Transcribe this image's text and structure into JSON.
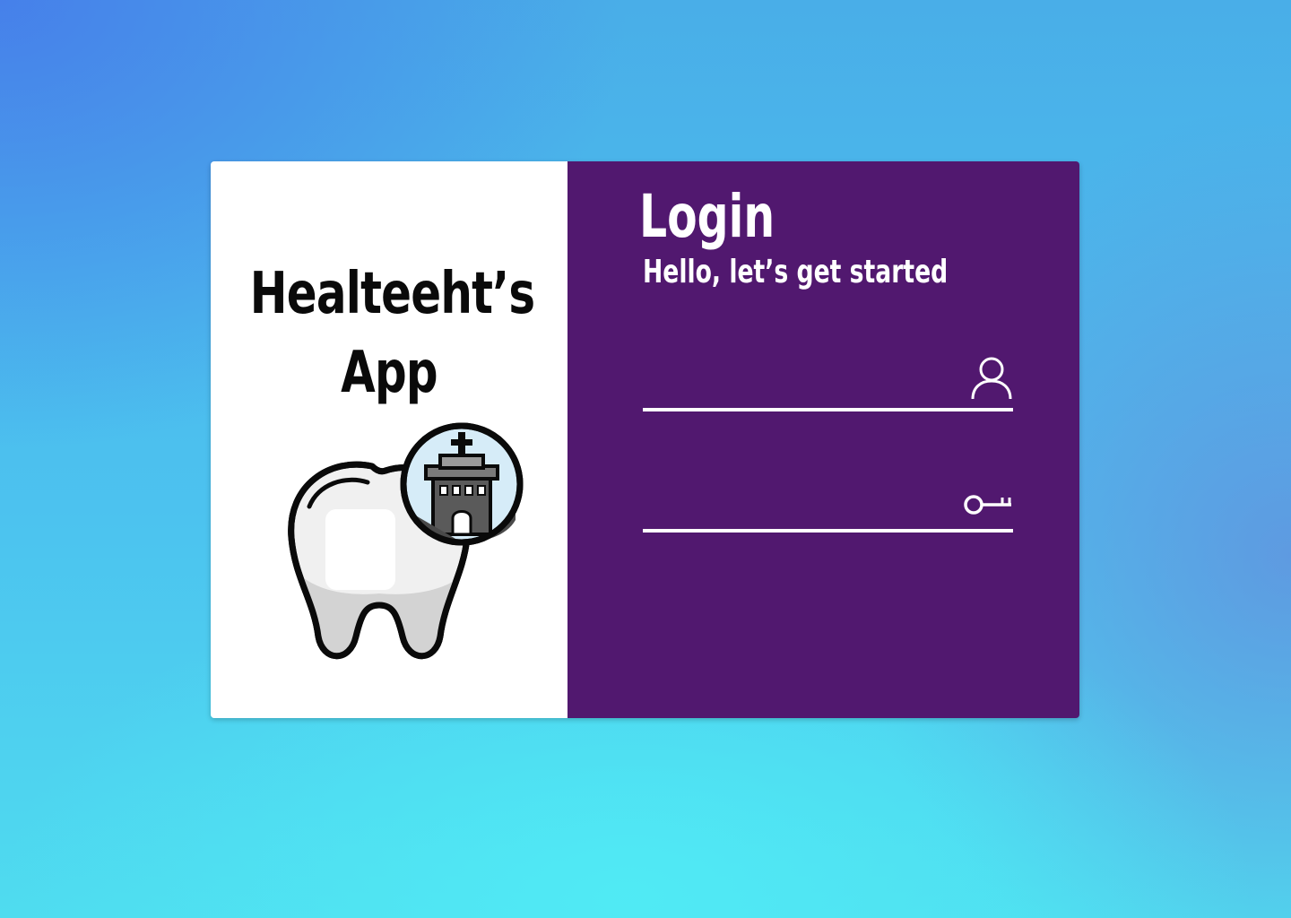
{
  "brand": {
    "title_line1": "Healteeht’s",
    "title_line2": "App",
    "logo_icon": "tooth-with-clinic-icon"
  },
  "login": {
    "title": "Login",
    "subtitle": "Hello, let’s get started",
    "username": {
      "value": "",
      "placeholder": "",
      "icon": "user-icon"
    },
    "password": {
      "value": "",
      "placeholder": "",
      "icon": "key-icon"
    }
  },
  "colors": {
    "panel_purple": "#51186f",
    "card_white": "#ffffff",
    "background_blue": "#4cc2ef",
    "background_cyan": "#50ebf5"
  }
}
